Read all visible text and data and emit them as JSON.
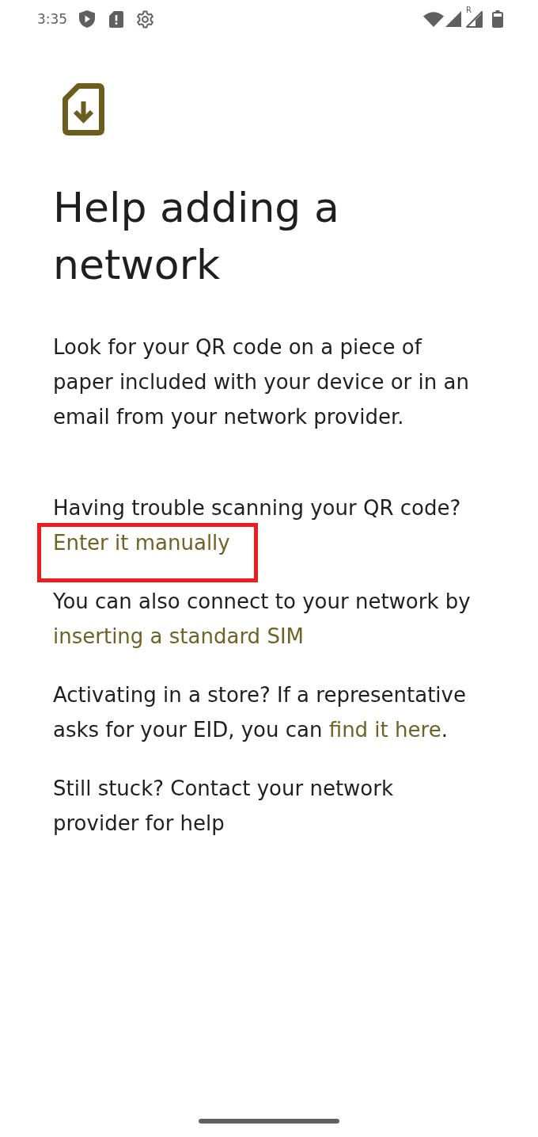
{
  "status_bar": {
    "time": "3:35",
    "roaming_indicator": "R"
  },
  "header": {
    "title": "Help adding a network"
  },
  "description": "Look for your QR code on a piece of paper included with your device or in an email from your network provider.",
  "help_items": [
    {
      "parts": [
        {
          "kind": "text",
          "text": "Having trouble scanning your QR code? "
        },
        {
          "kind": "link",
          "text": "Enter it manually",
          "highlighted": true
        }
      ]
    },
    {
      "parts": [
        {
          "kind": "text",
          "text": "You can also connect to your network by "
        },
        {
          "kind": "link",
          "text": "inserting a standard SIM",
          "highlighted": false
        }
      ]
    },
    {
      "parts": [
        {
          "kind": "text",
          "text": "Activating in a store? If a representative asks for your EID, you can "
        },
        {
          "kind": "link",
          "text": "find it here",
          "highlighted": false
        },
        {
          "kind": "text",
          "text": "."
        }
      ]
    },
    {
      "parts": [
        {
          "kind": "text",
          "text": "Still stuck? Contact your network provider for help"
        }
      ]
    }
  ]
}
